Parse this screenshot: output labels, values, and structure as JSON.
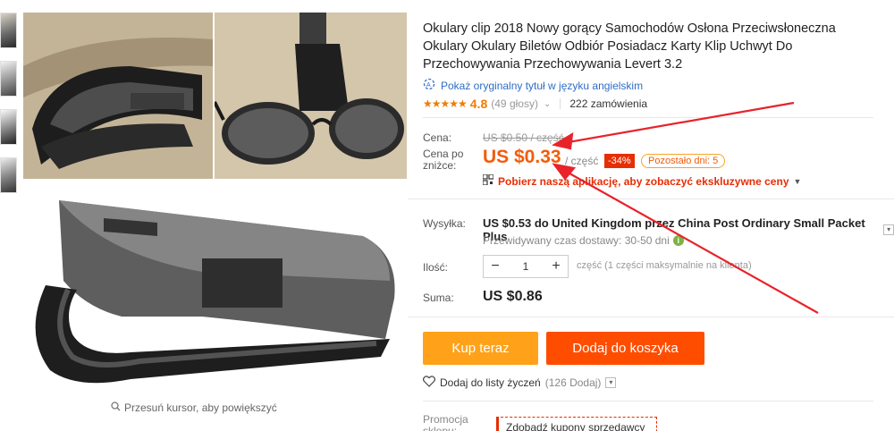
{
  "product": {
    "title": "Okulary clip 2018 Nowy gorący Samochodów Osłona Przeciwsłoneczna Okulary Okulary Biletów Odbiór Posiadacz Karty Klip Uchwyt Do Przechowywania Przechowywania Levert 3.2",
    "translate_link": "Pokaż oryginalny tytuł w języku angielskim",
    "rating_value": "4.8",
    "rating_votes": "(49 głosy)",
    "orders": "222 zamówienia",
    "zoom_hint": "Przesuń kursor, aby powiększyć",
    "stars": "★★★★★",
    "rating_stars_filled": 4.8
  },
  "price": {
    "old_label": "Cena:",
    "old_value": "US $0.50 / część",
    "new_label": "Cena po zniżce:",
    "new_value": "US $0.33",
    "per_unit": "/ część",
    "discount": "-34%",
    "remaining": "Pozostało dni: 5",
    "app_promo": "Pobierz naszą aplikację, aby zobaczyć ekskluzywne ceny"
  },
  "shipping": {
    "label": "Wysyłka:",
    "value": "US $0.53 do United Kingdom przez China Post Ordinary Small Packet Plus",
    "delivery": "Przewidywany czas dostawy: 30-50 dni",
    "info_icon": "i"
  },
  "quantity": {
    "label": "Ilość:",
    "minus": "−",
    "plus": "+",
    "value": "1",
    "note": "część (1 części maksymalnie na klienta)"
  },
  "total": {
    "label": "Suma:",
    "value": "US $0.86"
  },
  "actions": {
    "buy_now": "Kup teraz",
    "add_to_cart": "Dodaj do koszyka",
    "wishlist": "Dodaj do listy życzeń",
    "wishlist_count": "(126 Dodaj)"
  },
  "promotion": {
    "label": "Promocja sklepu:",
    "coupon": "Zdobądź kupony sprzedawcy"
  },
  "colors": {
    "accent_orange": "#ffa21a",
    "accent_red": "#ff4d00",
    "price": "#f25c0a",
    "annotation_arrow": "#e8232a"
  }
}
